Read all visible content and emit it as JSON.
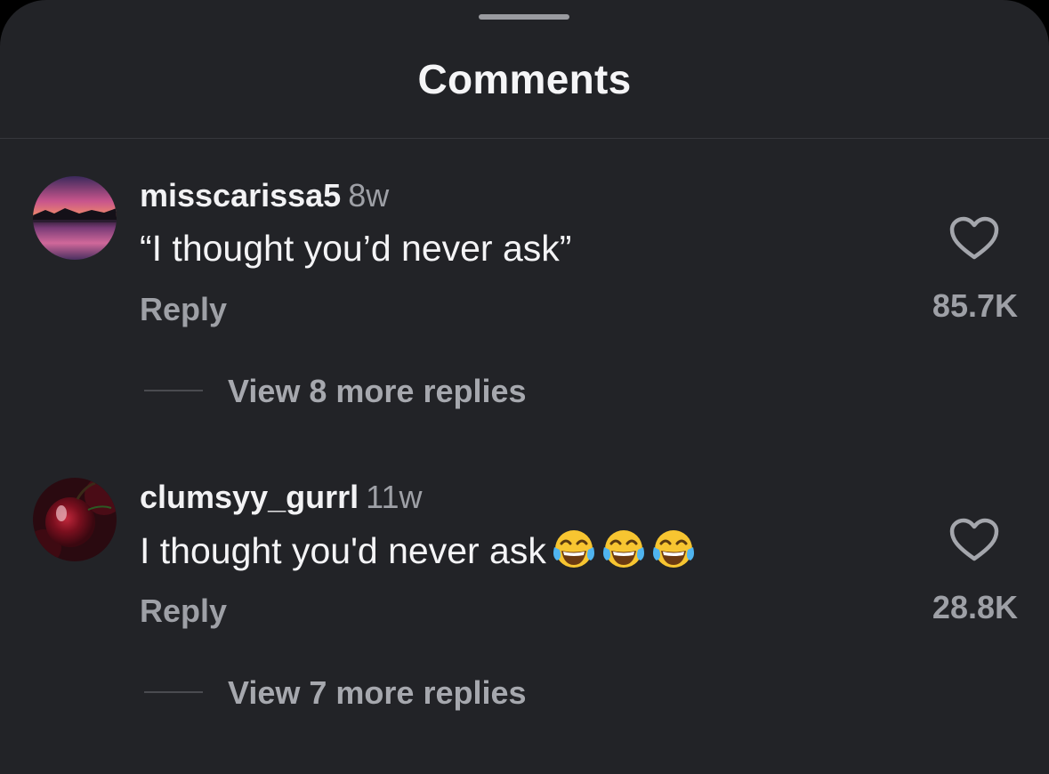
{
  "header": {
    "title": "Comments"
  },
  "comments": [
    {
      "username": "misscarissa5",
      "time": "8w",
      "text": "“I thought you’d never ask”",
      "reply_label": "Reply",
      "likes": "85.7K",
      "view_replies": "View 8 more replies"
    },
    {
      "username": "clumsyy_gurrl",
      "time": "11w",
      "text": "I thought you'd never ask",
      "emoji": [
        "tears-of-joy-emoji",
        "tears-of-joy-emoji",
        "tears-of-joy-emoji"
      ],
      "reply_label": "Reply",
      "likes": "28.8K",
      "view_replies": "View 7 more replies"
    }
  ],
  "colors": {
    "background": "#222327",
    "primary_text": "#f4f4f6",
    "secondary_text": "#9ea0a6"
  }
}
